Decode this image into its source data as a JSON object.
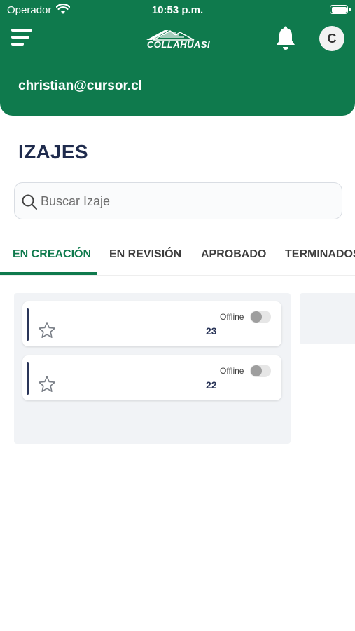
{
  "status_bar": {
    "carrier": "Operador",
    "time": "10:53 p.m."
  },
  "header": {
    "logo_text": "COLLAHUASI",
    "avatar_initial": "C",
    "user_email": "christian@cursor.cl"
  },
  "page": {
    "title": "IZAJES"
  },
  "search": {
    "placeholder": "Buscar Izaje"
  },
  "tabs": [
    {
      "label": "EN CREACIÓN",
      "active": true
    },
    {
      "label": "EN REVISIÓN",
      "active": false
    },
    {
      "label": "APROBADO",
      "active": false
    },
    {
      "label": "TERMINADOS",
      "active": false
    }
  ],
  "cards": [
    {
      "offline_label": "Offline",
      "number": "23",
      "offline_enabled": false,
      "favorite": false
    },
    {
      "offline_label": "Offline",
      "number": "22",
      "offline_enabled": false,
      "favorite": false
    }
  ],
  "colors": {
    "brand_green": "#0f7a4d",
    "title_navy": "#1f2b4d"
  }
}
